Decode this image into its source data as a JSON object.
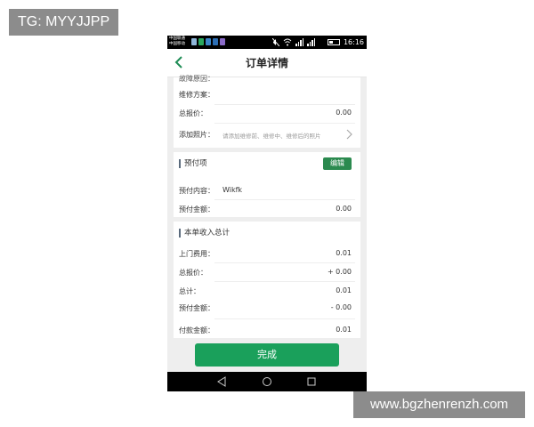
{
  "watermark_top": "TG: MYYJJPP",
  "watermark_bottom": "www.bgzhenrenzh.com",
  "status_bar": {
    "carrier_line1": "中国联通",
    "carrier_line2": "中国移动",
    "time": "16:16"
  },
  "header": {
    "title": "订单详情",
    "back_icon": "chevron-left-icon"
  },
  "repair": {
    "cut_label": "故障原因：",
    "plan_label": "维修方案：",
    "plan_value": "",
    "quote_label": "总报价：",
    "quote_value": "0.00",
    "photo_label": "添加照片：",
    "photo_hint": "请添加维修前、维修中、维修后的照片"
  },
  "prepaid": {
    "title": "预付项",
    "edit_label": "编辑",
    "content_label": "预付内容：",
    "content_value": "Wikfk",
    "amount_label": "预付金额：",
    "amount_value": "0.00"
  },
  "income": {
    "title": "本单收入总计",
    "rows": [
      {
        "label": "上门费用：",
        "value": "0.01"
      },
      {
        "label": "总报价：",
        "value": "+ 0.00"
      },
      {
        "label": "总计：",
        "value": "0.01"
      },
      {
        "label": "预付金额：",
        "value": "- 0.00"
      },
      {
        "label": "付款金额：",
        "value": "0.01"
      }
    ]
  },
  "done_button": "完成",
  "colors": {
    "accent_green": "#1aa05b",
    "edit_green": "#2b8a4f",
    "back_green": "#1e8c55"
  }
}
